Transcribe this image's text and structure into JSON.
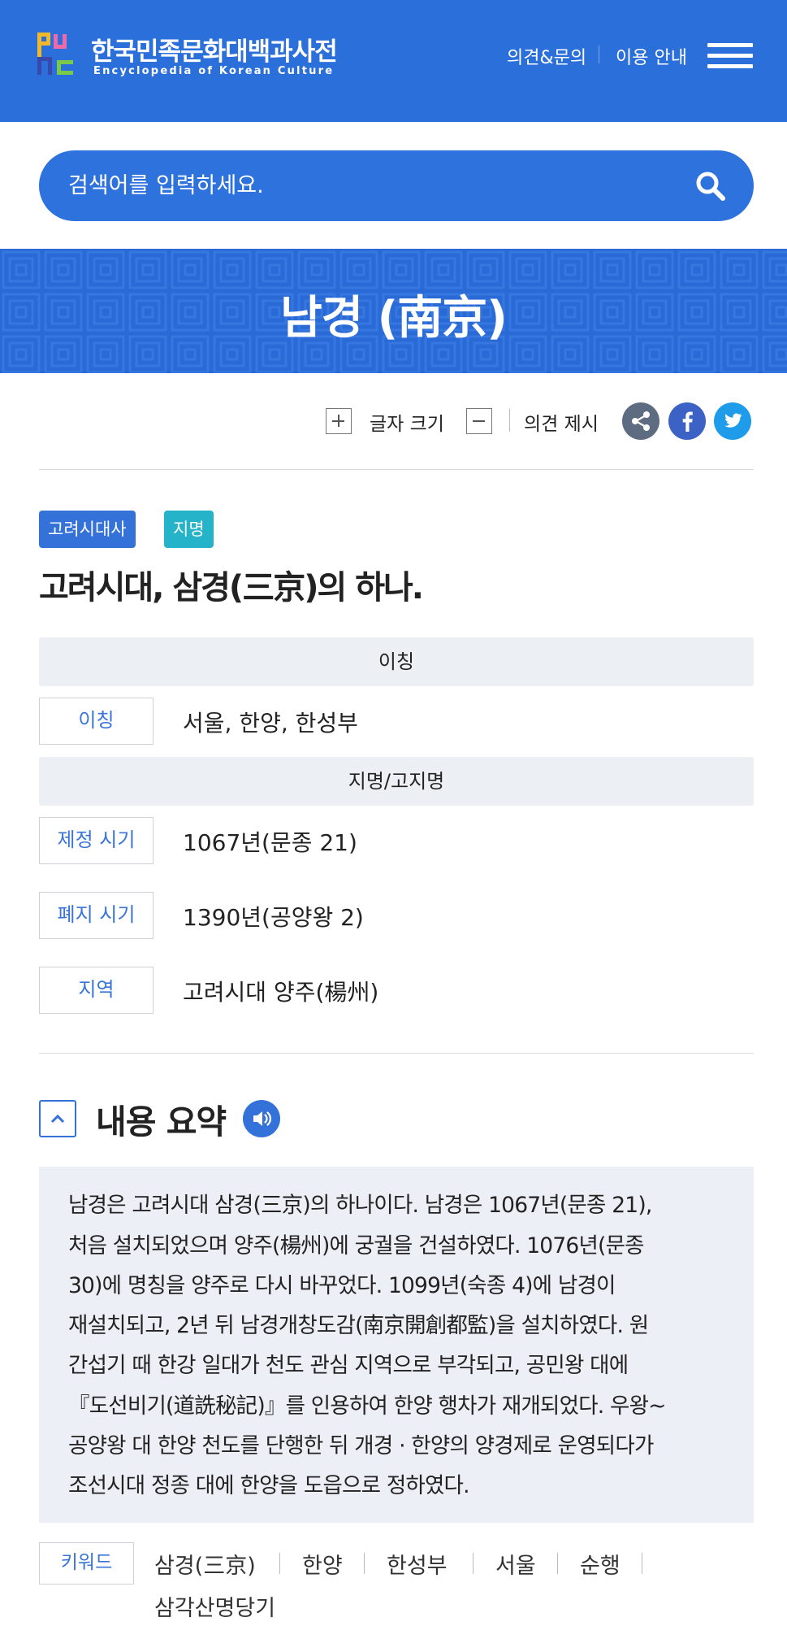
{
  "header": {
    "logo_title": "한국민족문화대백과사전",
    "logo_subtitle": "Encyclopedia of Korean Culture",
    "link_feedback": "의견&문의",
    "link_guide": "이용 안내"
  },
  "search": {
    "placeholder": "검색어를 입력하세요."
  },
  "article": {
    "title": "남경 (南京)",
    "toolbar": {
      "font_size_label": "글자 크기",
      "suggest_label": "의견 제시"
    },
    "tags": [
      "고려시대사",
      "지명"
    ],
    "lead": "고려시대, 삼경(三京)의 하나.",
    "info": {
      "section_alias": "이칭",
      "alias_label": "이칭",
      "alias_value": "서울, 한양, 한성부",
      "section_place": "지명/고지명",
      "established_label": "제정 시기",
      "established_value": "1067년(문종 21)",
      "abolished_label": "폐지 시기",
      "abolished_value": "1390년(공양왕 2)",
      "region_label": "지역",
      "region_value_main": "고려시대 양주",
      "region_value_hanja": "(楊州)"
    },
    "summary": {
      "title": "내용 요약",
      "lines": [
        "남경은 고려시대 삼경(三京)의 하나이다. 남경은 1067년(문종 21),",
        "처음 설치되었으며 양주(楊州)에 궁궐을 건설하였다. 1076년(문종",
        "30)에 명칭을 양주로 다시 바꾸었다. 1099년(숙종 4)에 남경이",
        "재설치되고, 2년 뒤 남경개창도감(南京開創都監)을 설치하였다. 원",
        "간섭기 때 한강 일대가 천도 관심 지역으로 부각되고, 공민왕 대에",
        "『도선비기(道詵秘記)』를 인용하여 한양 행차가 재개되었다. 우왕~",
        "공양왕 대 한양 천도를 단행한 뒤 개경 · 한양의 양경제로 운영되다가",
        "조선시대 정종 대에 한양을 도읍으로 정하였다."
      ]
    },
    "keywords": {
      "label": "키워드",
      "items": [
        "삼경(三京)",
        "한양",
        "한성부",
        "서울",
        "순행",
        "삼각산명당기"
      ]
    }
  },
  "colors": {
    "brand_blue": "#2b6fdb",
    "tag_teal": "#25b3c9",
    "facebook": "#3b62c4",
    "twitter": "#1e9be9",
    "share": "#5d6c80"
  },
  "icons": [
    "menu-icon",
    "search-icon",
    "plus-icon",
    "minus-icon",
    "share-icon",
    "facebook-icon",
    "twitter-icon",
    "chevron-up-icon",
    "speaker-icon"
  ]
}
